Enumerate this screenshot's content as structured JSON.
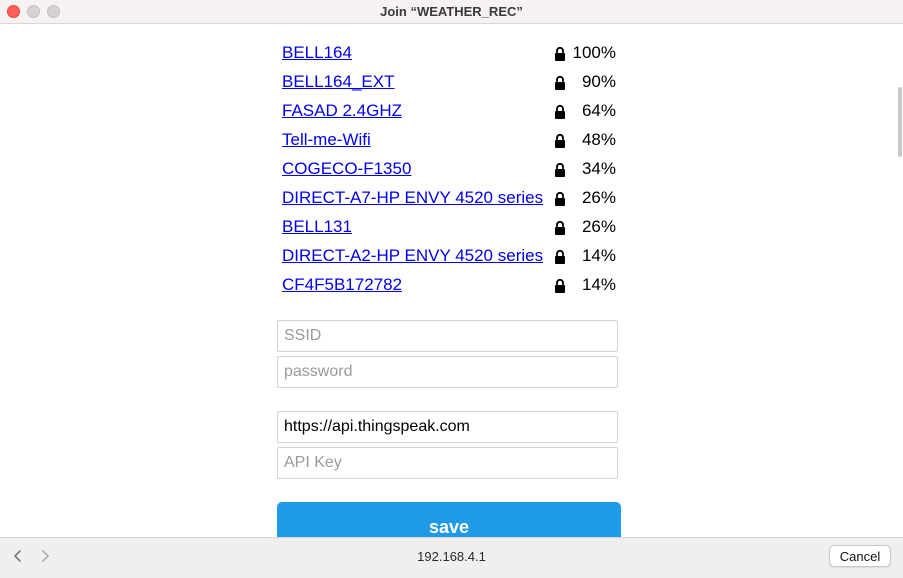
{
  "window": {
    "title": "Join “WEATHER_REC”"
  },
  "networks": [
    {
      "ssid": "BELL164",
      "strength": "100%",
      "icon": "lock-icon"
    },
    {
      "ssid": "BELL164_EXT",
      "strength": "90%",
      "icon": "lock-icon"
    },
    {
      "ssid": "FASAD 2.4GHZ",
      "strength": "64%",
      "icon": "lock-icon"
    },
    {
      "ssid": "Tell-me-Wifi",
      "strength": "48%",
      "icon": "lock-icon"
    },
    {
      "ssid": "COGECO-F1350",
      "strength": "34%",
      "icon": "lock-icon"
    },
    {
      "ssid": "DIRECT-A7-HP ENVY 4520 series",
      "strength": "26%",
      "icon": "lock-icon"
    },
    {
      "ssid": "BELL131",
      "strength": "26%",
      "icon": "lock-icon"
    },
    {
      "ssid": "DIRECT-A2-HP ENVY 4520 series",
      "strength": "14%",
      "icon": "lock-icon"
    },
    {
      "ssid": "CF4F5B172782",
      "strength": "14%",
      "icon": "lock-icon"
    }
  ],
  "form": {
    "ssid_placeholder": "SSID",
    "ssid_value": "",
    "password_placeholder": "password",
    "password_value": "",
    "server_value": "https://api.thingspeak.com",
    "api_key_placeholder": "API Key",
    "api_key_value": "",
    "save_label": "save"
  },
  "bottom_bar": {
    "url": "192.168.4.1",
    "cancel_label": "Cancel",
    "back_icon": "chevron-left-icon",
    "forward_icon": "chevron-right-icon"
  },
  "colors": {
    "link": "#0000ee",
    "save_button": "#1f9ae6",
    "close_button": "#ff5f57"
  }
}
